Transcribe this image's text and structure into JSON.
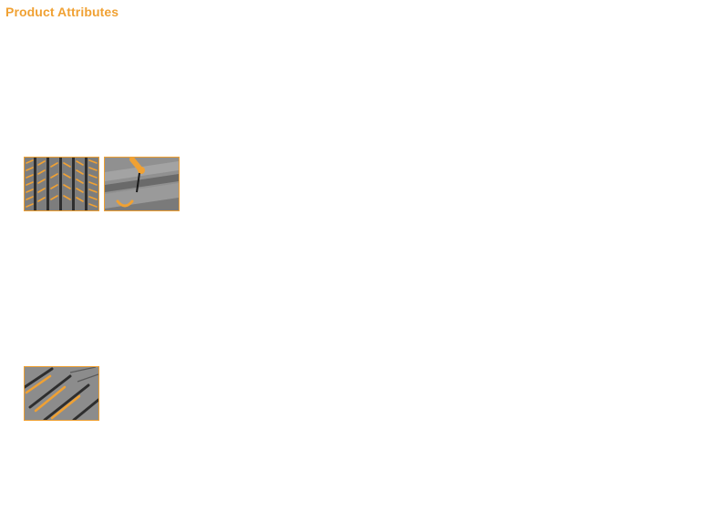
{
  "section": {
    "title": "Product Attributes"
  },
  "colors": {
    "accent": "#f0a133",
    "tread_gray": "#8a8a8a",
    "groove_dark": "#3a3a3a"
  },
  "thumbnails": [
    {
      "icon": "tread-pattern-icon"
    },
    {
      "icon": "sipe-cut-icon"
    },
    {
      "icon": "diagonal-groove-icon"
    }
  ]
}
